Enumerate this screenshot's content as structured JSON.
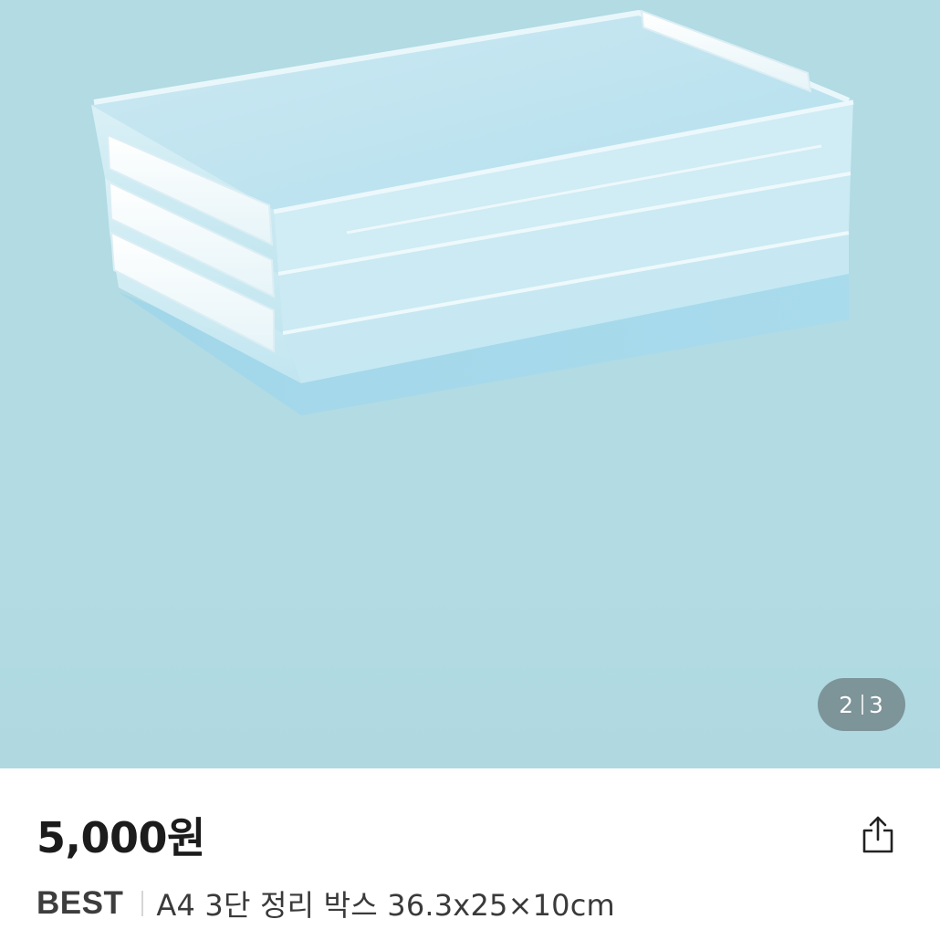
{
  "gallery": {
    "current_page": "2",
    "total_pages": "3",
    "background_color": "#b2dbe3",
    "product_image": "stacked-clear-a4-organizer-boxes"
  },
  "product": {
    "price": "5,000원",
    "brand": "BEST",
    "name": "A4 3단 정리 박스 36.3x25×10cm"
  },
  "actions": {
    "share_icon": "share-icon"
  }
}
